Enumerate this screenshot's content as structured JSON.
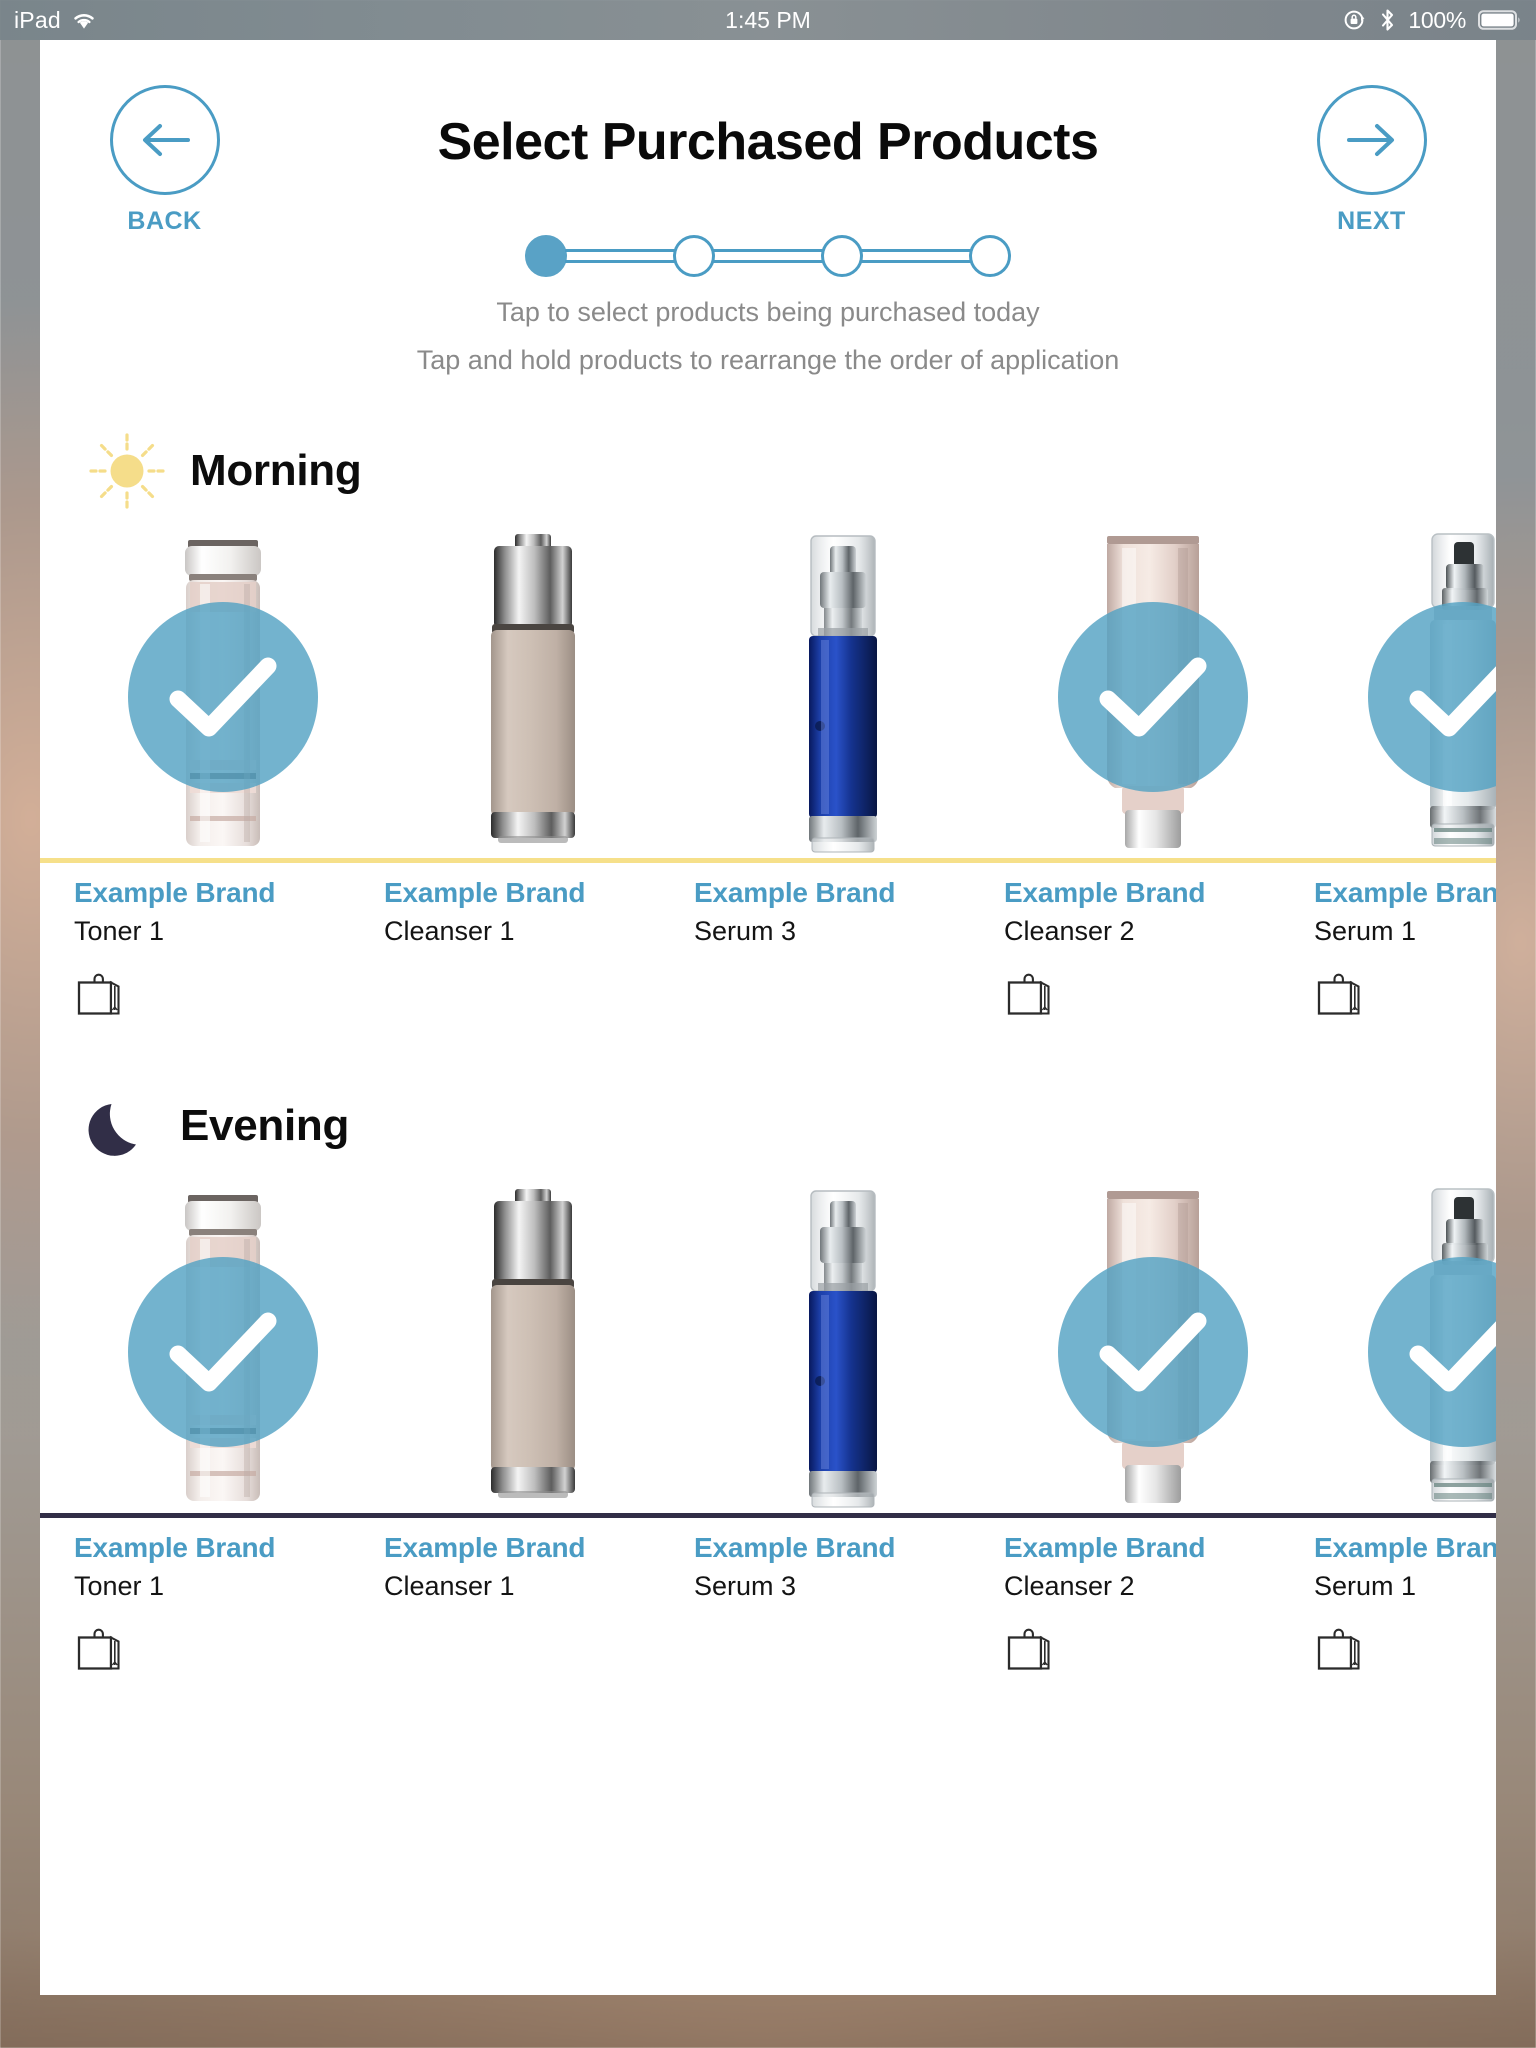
{
  "status_bar": {
    "device_label": "iPad",
    "wifi_icon": "wifi-icon",
    "time": "1:45 PM",
    "rotation_lock_icon": "rotation-lock-icon",
    "bluetooth_icon": "bluetooth-icon",
    "battery_percent": "100%",
    "battery_icon": "battery-full-icon"
  },
  "header": {
    "title": "Select Purchased Products",
    "back_label": "BACK",
    "back_icon": "arrow-left-circle-icon",
    "next_label": "NEXT",
    "next_icon": "arrow-right-circle-icon"
  },
  "stepper": {
    "total_steps": 4,
    "current_step": 1
  },
  "instructions": {
    "line1": "Tap to select products being purchased today",
    "line2": "Tap and hold products to rearrange the order of application"
  },
  "colors": {
    "accent_blue": "#4a9cc4",
    "check_blue": "#54a2c3",
    "morning_rule": "#f6e08a",
    "evening_rule": "#312e47",
    "sun": "#f5dd8a",
    "moon": "#312e47"
  },
  "sections": [
    {
      "id": "morning",
      "title": "Morning",
      "icon": "sun-icon",
      "rule_color": "#f6e08a",
      "products": [
        {
          "brand": "Example Brand",
          "name": "Toner 1",
          "selected": true,
          "bag_icon": "shopping-bag-icon",
          "art": "toner"
        },
        {
          "brand": "Example Brand",
          "name": "Cleanser 1",
          "selected": false,
          "bag_icon": null,
          "art": "cleanser1"
        },
        {
          "brand": "Example Brand",
          "name": "Serum 3",
          "selected": false,
          "bag_icon": null,
          "art": "serum3"
        },
        {
          "brand": "Example Brand",
          "name": "Cleanser 2",
          "selected": true,
          "bag_icon": "shopping-bag-icon",
          "art": "tube"
        },
        {
          "brand": "Example Brand",
          "name": "Serum 1",
          "selected": true,
          "bag_icon": "shopping-bag-icon",
          "art": "serum1"
        }
      ]
    },
    {
      "id": "evening",
      "title": "Evening",
      "icon": "moon-icon",
      "rule_color": "#312e47",
      "products": [
        {
          "brand": "Example Brand",
          "name": "Toner 1",
          "selected": true,
          "bag_icon": "shopping-bag-icon",
          "art": "toner"
        },
        {
          "brand": "Example Brand",
          "name": "Cleanser 1",
          "selected": false,
          "bag_icon": null,
          "art": "cleanser1"
        },
        {
          "brand": "Example Brand",
          "name": "Serum 3",
          "selected": false,
          "bag_icon": null,
          "art": "serum3"
        },
        {
          "brand": "Example Brand",
          "name": "Cleanser 2",
          "selected": true,
          "bag_icon": "shopping-bag-icon",
          "art": "tube"
        },
        {
          "brand": "Example Brand",
          "name": "Serum 1",
          "selected": true,
          "bag_icon": "shopping-bag-icon",
          "art": "serum1"
        }
      ]
    }
  ]
}
